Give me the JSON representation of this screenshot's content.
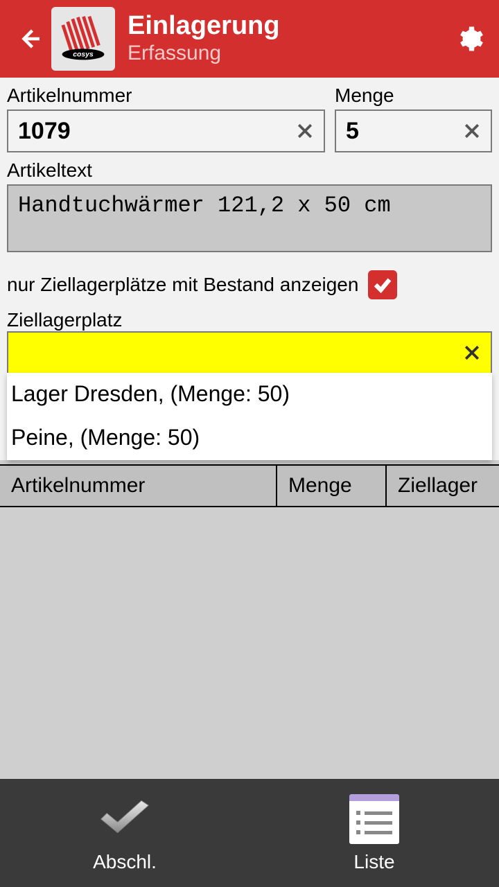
{
  "header": {
    "title": "Einlagerung",
    "subtitle": "Erfassung"
  },
  "form": {
    "artikelnummer_label": "Artikelnummer",
    "artikelnummer_value": "1079",
    "menge_label": "Menge",
    "menge_value": "5",
    "artikeltext_label": "Artikeltext",
    "artikeltext_value": "Handtuchwärmer 121,2 x 50 cm",
    "filter_label": "nur Ziellagerplätze mit Bestand anzeigen",
    "filter_checked": true,
    "ziellagerplatz_label": "Ziellagerplatz",
    "ziellagerplatz_value": ""
  },
  "dropdown": {
    "items": [
      "Lager Dresden, (Menge: 50)",
      "Peine, (Menge: 50)"
    ]
  },
  "table": {
    "col1": "Artikelnummer",
    "col2": "Menge",
    "col3": "Ziellager"
  },
  "bottom": {
    "abschl": "Abschl.",
    "liste": "Liste"
  },
  "colors": {
    "primary": "#d32f2f",
    "highlight": "#ffff00"
  }
}
